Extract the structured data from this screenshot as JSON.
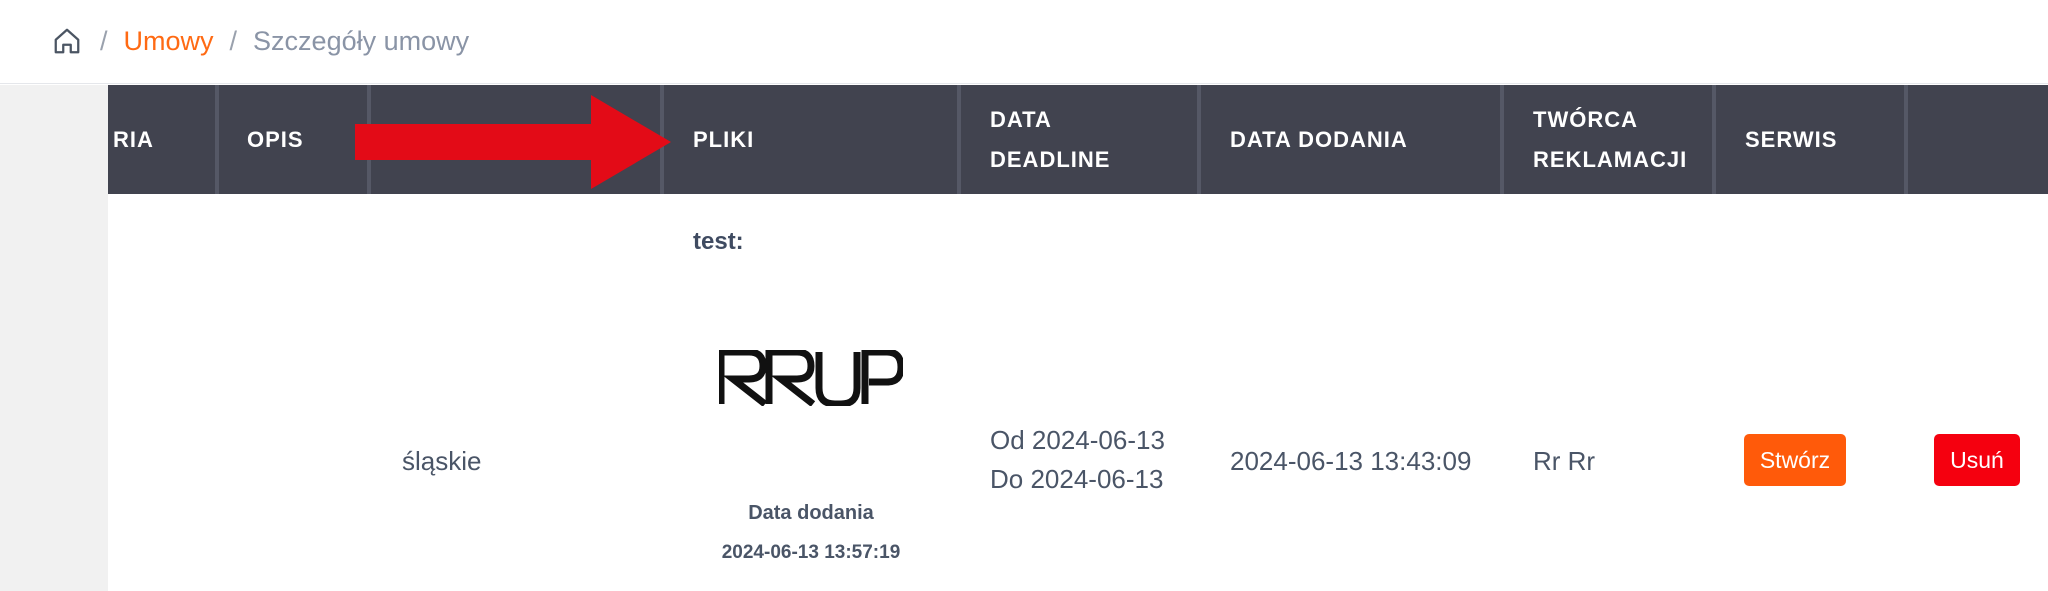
{
  "breadcrumb": {
    "home_icon": "home-icon",
    "separator": "/",
    "contracts": "Umowy",
    "current": "Szczegóły umowy"
  },
  "table": {
    "headers": {
      "kategoria": "RIA",
      "opis": "OPIS",
      "pliki": "PLIKI",
      "data_deadline_line1": "DATA",
      "data_deadline_line2": "DEADLINE",
      "data_dodania": "DATA DODANIA",
      "tworca_line1": "TWÓRCA",
      "tworca_line2": "REKLAMACJI",
      "serwis": "SERWIS"
    },
    "row": {
      "region": "śląskie",
      "file": {
        "title": "test:",
        "logo_text": "RRUP",
        "added_label": "Data dodania",
        "added_date": "2024-06-13 13:57:19"
      },
      "deadline_from": "Od 2024-06-13",
      "deadline_to": "Do 2024-06-13",
      "date_added": "2024-06-13 13:43:09",
      "creator": "Rr Rr",
      "create_label": "Stwórz",
      "delete_label": "Usuń"
    }
  },
  "annotation": {
    "arrow_icon": "red-arrow-icon",
    "arrow_color": "#e30b17"
  },
  "colors": {
    "accent": "#ff6a13",
    "header_bg": "#41434f",
    "create_button": "#ff5a0a",
    "delete_button": "#f5000f"
  }
}
